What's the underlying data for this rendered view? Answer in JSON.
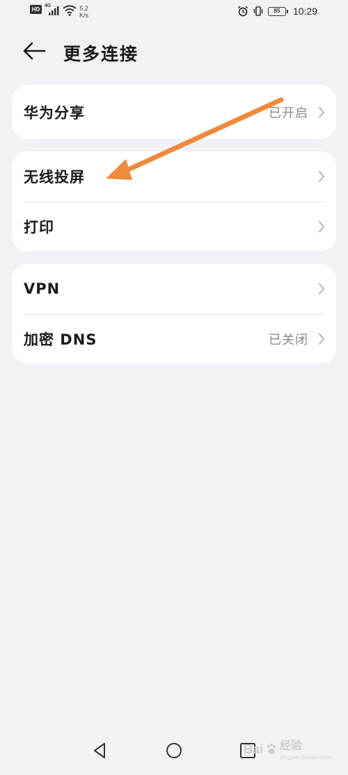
{
  "status_bar": {
    "hd_badge": "HD",
    "network_type": "4G",
    "speed_value": "5.2",
    "speed_unit": "K/s",
    "battery": "85",
    "time": "10:29",
    "icons": [
      "hd-icon",
      "signal-icon",
      "wifi-icon",
      "alarm-icon",
      "vibrate-icon",
      "battery-icon"
    ]
  },
  "header": {
    "title": "更多连接",
    "back_icon": "back-arrow-icon"
  },
  "cards": [
    {
      "rows": [
        {
          "label": "华为分享",
          "value": "已开启"
        }
      ]
    },
    {
      "rows": [
        {
          "label": "无线投屏",
          "value": ""
        },
        {
          "label": "打印",
          "value": ""
        }
      ]
    },
    {
      "rows": [
        {
          "label": "VPN",
          "value": ""
        },
        {
          "label": "加密 DNS",
          "value": "已关闭"
        }
      ]
    }
  ],
  "annotation": {
    "color": "#f08a3c"
  },
  "navbar": {
    "icons": [
      "nav-back-icon",
      "nav-home-icon",
      "nav-recents-icon"
    ]
  },
  "watermark": {
    "brand": "Bai",
    "suffix": "经验",
    "sub": "jingyan.baidu.com"
  },
  "colors": {
    "background": "#f1f2f6",
    "card": "#ffffff",
    "primary_text": "#1a1a1a",
    "secondary_text": "#8a8a8a",
    "chevron": "#b5b5b5"
  }
}
